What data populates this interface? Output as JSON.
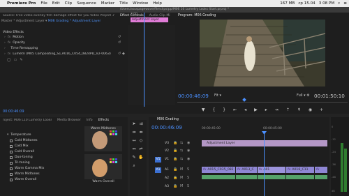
{
  "menubar": {
    "app": "Premiere Pro",
    "items": [
      "File",
      "Edit",
      "Clip",
      "Sequence",
      "Marker",
      "Title",
      "Window",
      "Help"
    ],
    "status": {
      "memory": "167 MB",
      "time": "cp 15.04",
      "time2": "3 08 PM"
    }
  },
  "titlebar": {
    "path": "/Users/asuspagewave/filmclips/pp/M06 10 Lumetry Looks Start.prproj *"
  },
  "effect_controls": {
    "tabs": [
      "Source: Free video overlay film damage effect for you Video Project .mp4",
      "Effect Controls",
      "Audio Clip Mi"
    ],
    "active_tab": "Effect Controls",
    "source_label": "Master * Adjustment Layer",
    "sequence_label": "M06 Grading * Adjustment Layer",
    "ruler_time": "3:00",
    "layer_bar_label": "Adjustment Layer",
    "header": "Video Effects",
    "rows": [
      {
        "label": "Motion"
      },
      {
        "label": "Opacity"
      },
      {
        "label": "Time Remapping"
      },
      {
        "label": "Lumetri (M05 Compositing_S1,A016_C054_0824PD_V2-0063)"
      }
    ],
    "timecode": "00:00:46:09"
  },
  "program": {
    "title": "Program: M06 Grading",
    "timecode": "00:00:46:09",
    "fit": "Fit",
    "quality": "Full",
    "duration": "00:01:50:10",
    "controls": [
      "marker-icon",
      "in-icon",
      "out-icon",
      "goto-in-icon",
      "step-back-icon",
      "play-icon",
      "step-forward-icon",
      "goto-out-icon",
      "lift-icon",
      "extract-icon",
      "export-frame-icon",
      "add-icon"
    ],
    "playhead_fraction": 0.39
  },
  "presets": {
    "tabs": [
      "roject: M06 L10 Lumetry Looks Start",
      "Media Browser",
      "Info",
      "Effects"
    ],
    "active_tab": "Effects",
    "items": [
      "Temperature",
      "Cold Midtones",
      "Cold Mix",
      "Cold Overall",
      "Duo-toning",
      "Tri-toning",
      "Warm Gamma Mix",
      "Warm Midtones",
      "Warm Overall"
    ],
    "thumbnails": [
      "Warm Midtones",
      "Warm Overall"
    ]
  },
  "timeline": {
    "tab": "M06 Grading",
    "timecode": "00:00:46:09",
    "ruler": [
      "00:00:45:00",
      "00:00:45:00"
    ],
    "tracks": [
      {
        "target": "",
        "name": "V3"
      },
      {
        "target": "",
        "name": "V2"
      },
      {
        "target": "V1",
        "name": "V1"
      },
      {
        "target": "A1",
        "name": "A1"
      },
      {
        "target": "",
        "name": "A2"
      },
      {
        "target": "",
        "name": "A3"
      }
    ],
    "adjustment_clip": "Adjustment Layer",
    "video_clips": [
      "A015_C035_082",
      "A013_C",
      "A01",
      "A016_C11",
      ""
    ],
    "audio_clip_count": 6
  },
  "meters": {
    "labels": [
      "0",
      "-12",
      "-24",
      "-36",
      "-48",
      "dB"
    ]
  },
  "colors": {
    "accent": "#4b90ff",
    "adjustment": "#b497c6",
    "video_clip": "#8f87d4",
    "audio_clip": "#56a36a",
    "effect_bar": "#e07cd7"
  }
}
